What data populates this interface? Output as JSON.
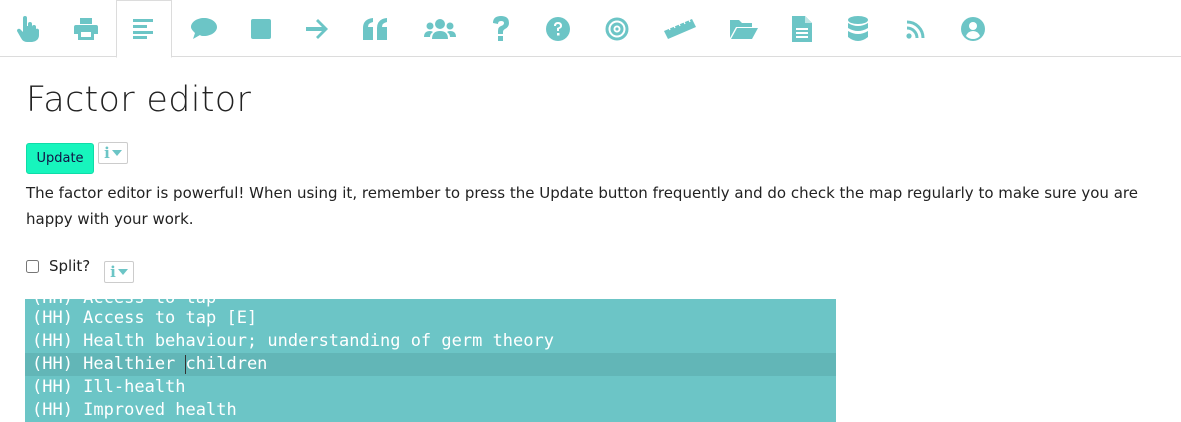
{
  "toolbar": {
    "icons": [
      "pointer-hand-icon",
      "print-icon",
      "align-left-icon",
      "comment-icon",
      "square-icon",
      "arrow-right-icon",
      "quote-icon",
      "users-icon",
      "question-icon",
      "question-circle-icon",
      "bullseye-icon",
      "ruler-icon",
      "folder-open-icon",
      "file-text-icon",
      "database-icon",
      "rss-icon",
      "user-circle-icon"
    ],
    "accent": "#6cc5c6",
    "active_index": 2
  },
  "page": {
    "title": "Factor editor",
    "update_label": "Update",
    "info_glyph": "i",
    "description": "The factor editor is powerful! When using it, remember to press the Update button frequently and do check the map regularly to make sure you are happy with your work.",
    "split_label": "Split?",
    "split_checked": false
  },
  "editor": {
    "lines": [
      "(HH) Access to tap",
      "(HH) Access to tap [E]",
      "(HH) Health behaviour; understanding of germ theory",
      "(HH) Healthier children",
      "(HH) Ill-health",
      "(HH) Improved health"
    ],
    "current_line_index": 3,
    "cursor_split": [
      "(HH) Healthier ",
      "children"
    ],
    "background": "#6cc5c6",
    "text_color": "#ffffff"
  },
  "colors": {
    "update_button": "#17f5bd"
  }
}
